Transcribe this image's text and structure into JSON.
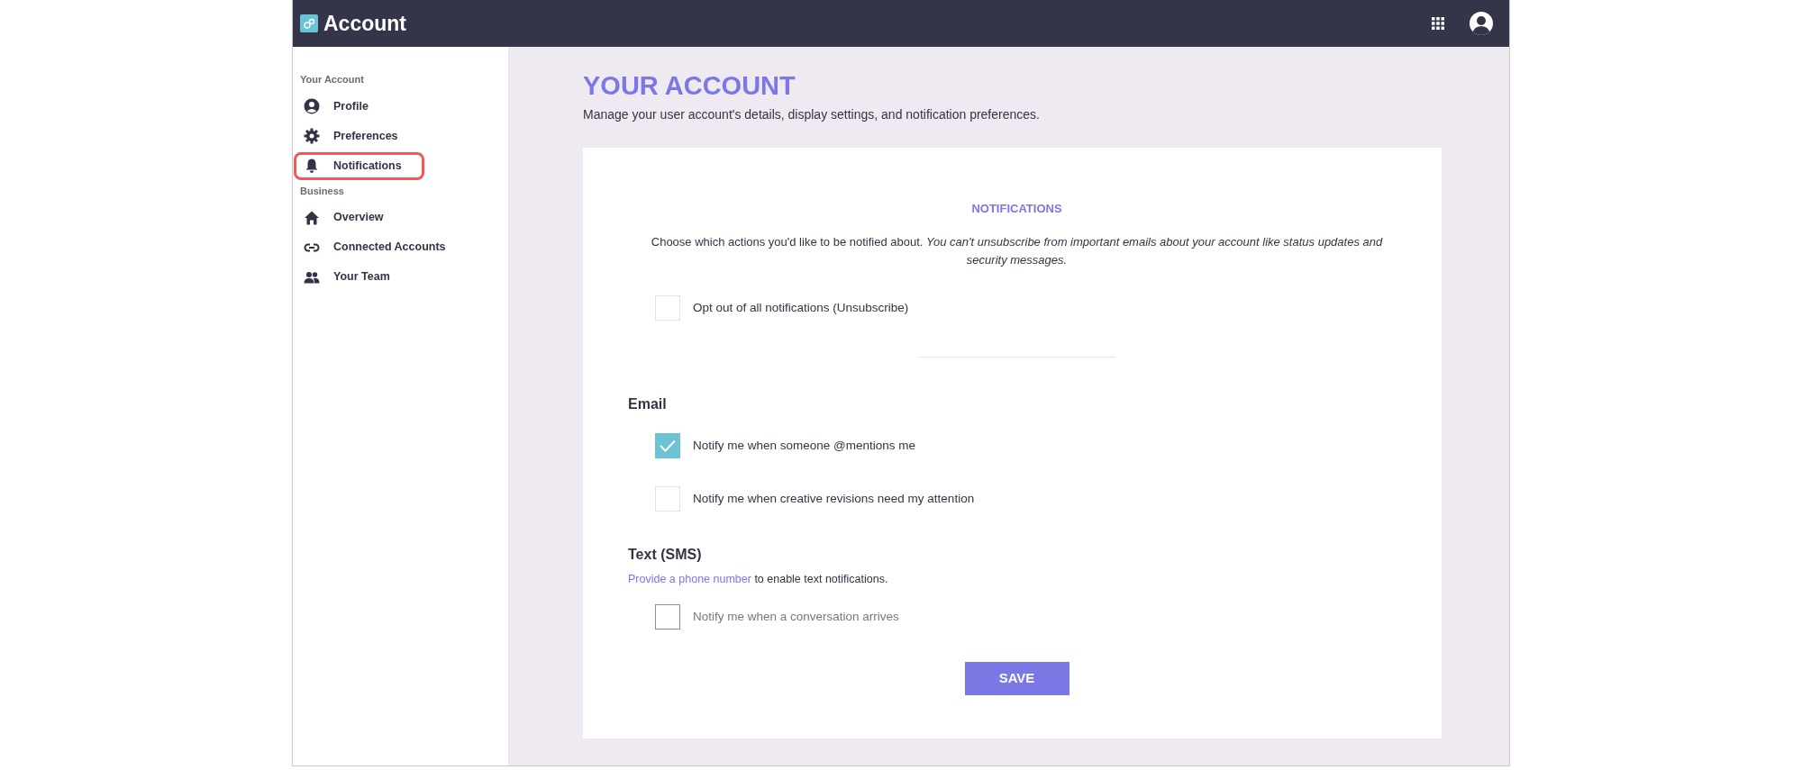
{
  "header": {
    "title": "Account"
  },
  "sidebar": {
    "groups": [
      {
        "label": "Your Account",
        "items": [
          {
            "label": "Profile",
            "kind": "person",
            "highlighted": false
          },
          {
            "label": "Preferences",
            "kind": "gear",
            "highlighted": false
          },
          {
            "label": "Notifications",
            "kind": "bell",
            "highlighted": true
          }
        ]
      },
      {
        "label": "Business",
        "items": [
          {
            "label": "Overview",
            "kind": "home",
            "highlighted": false
          },
          {
            "label": "Connected Accounts",
            "kind": "link",
            "highlighted": false
          },
          {
            "label": "Your Team",
            "kind": "people",
            "highlighted": false
          }
        ]
      }
    ]
  },
  "main": {
    "title": "YOUR ACCOUNT",
    "subtitle": "Manage your user account's details, display settings, and notification preferences.",
    "card": {
      "heading": "NOTIFICATIONS",
      "intro": "Choose which actions you'd like to be notified about. *You can't unsubscribe from important emails about your account like status updates and security messages.*",
      "opt_out": {
        "label": "Opt out of all notifications (Unsubscribe)",
        "checked": false,
        "disabled": false
      },
      "sections": [
        {
          "title": "Email",
          "options": [
            {
              "label": "Notify me when someone @mentions me",
              "checked": true,
              "disabled": false
            },
            {
              "label": "Notify me when creative revisions need my attention",
              "checked": false,
              "disabled": false
            }
          ]
        },
        {
          "title": "Text (SMS)",
          "note_link": "Provide a phone number",
          "note_text": "to enable text notifications.",
          "options": [
            {
              "label": "Notify me when a conversation arrives",
              "checked": false,
              "disabled": true
            }
          ]
        }
      ],
      "button": "SAVE"
    }
  }
}
